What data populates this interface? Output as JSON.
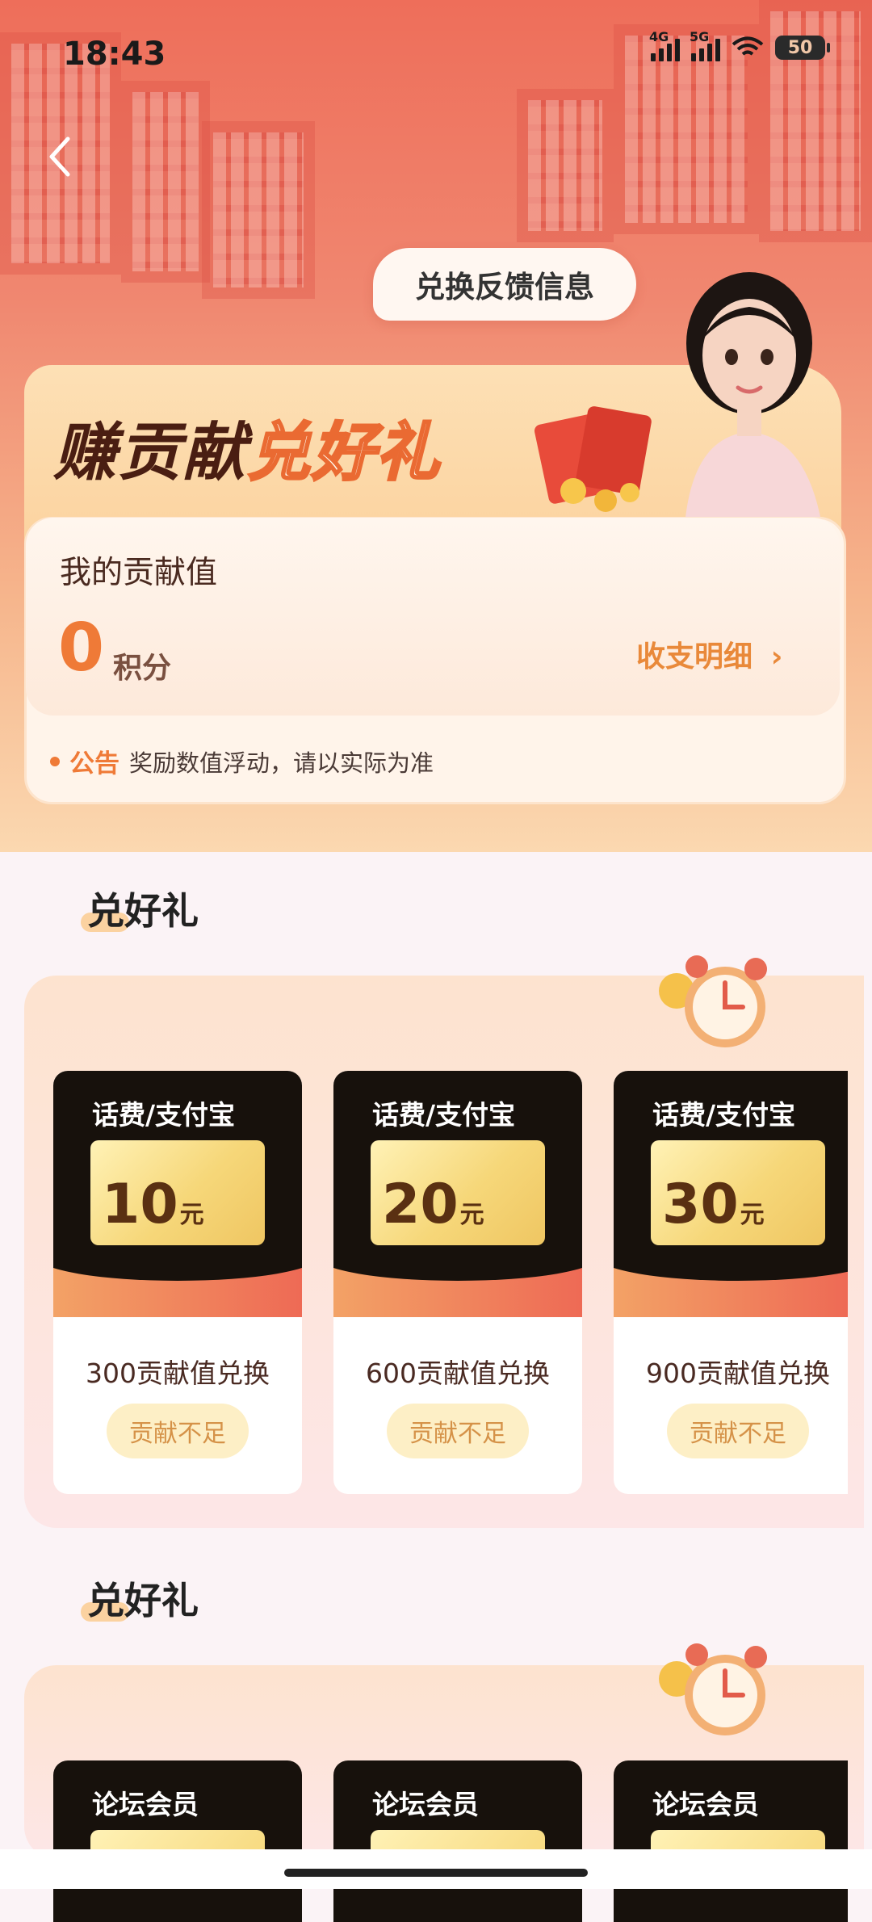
{
  "status_bar": {
    "time": "18:43",
    "net1": "4G",
    "net2": "5G",
    "battery": "50"
  },
  "header": {
    "feedback_label": "兑换反馈信息"
  },
  "banner": {
    "title_part1": "赚贡献",
    "title_part2": "兑好礼"
  },
  "points": {
    "label": "我的贡献值",
    "value": "0",
    "unit": "积分",
    "detail_link": "收支明细",
    "detail_chevron": "›",
    "notice_tag": "公告",
    "notice_text": "奖励数值浮动，请以实际为准"
  },
  "sections": [
    {
      "title": "兑好礼",
      "gifts": [
        {
          "category": "话费/支付宝",
          "amount": "10",
          "unit": "元",
          "cost": "300贡献值兑换",
          "button": "贡献不足"
        },
        {
          "category": "话费/支付宝",
          "amount": "20",
          "unit": "元",
          "cost": "600贡献值兑换",
          "button": "贡献不足"
        },
        {
          "category": "话费/支付宝",
          "amount": "30",
          "unit": "元",
          "cost": "900贡献值兑换",
          "button": "贡献不足"
        }
      ]
    },
    {
      "title": "兑好礼",
      "gifts": [
        {
          "category": "论坛会员"
        },
        {
          "category": "论坛会员"
        },
        {
          "category": "论坛会员"
        }
      ]
    }
  ],
  "colors": {
    "accent": "#ef7a37",
    "hero_top": "#ee6e5a",
    "card_dark": "#17110c",
    "button_bg": "#fdefc6"
  },
  "icons": [
    "back-icon",
    "signal-icon",
    "wifi-icon",
    "battery-icon",
    "chevron-right-icon",
    "alarm-clock-icon",
    "red-packet-icon"
  ]
}
